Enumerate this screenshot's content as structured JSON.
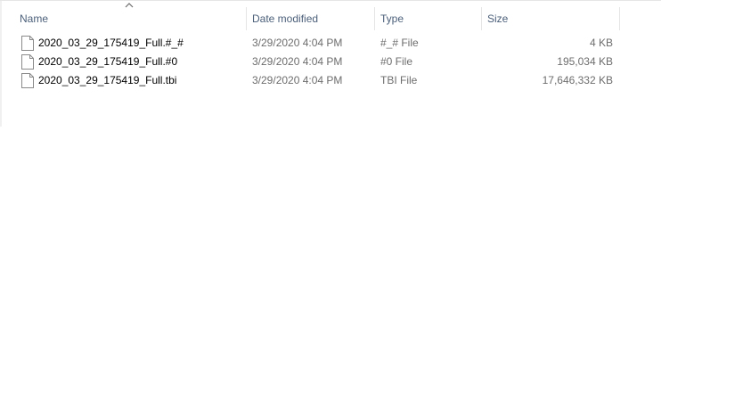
{
  "columns": {
    "name": "Name",
    "date_modified": "Date modified",
    "type": "Type",
    "size": "Size"
  },
  "sort": {
    "column": "name",
    "direction": "ascending",
    "icon": "sort-up-chevron-icon"
  },
  "files": [
    {
      "name": "2020_03_29_175419_Full.#_#",
      "date_modified": "3/29/2020 4:04 PM",
      "type": "#_# File",
      "size": "4 KB",
      "icon": "generic-file-icon"
    },
    {
      "name": "2020_03_29_175419_Full.#0",
      "date_modified": "3/29/2020 4:04 PM",
      "type": "#0 File",
      "size": "195,034 KB",
      "icon": "generic-file-icon"
    },
    {
      "name": "2020_03_29_175419_Full.tbi",
      "date_modified": "3/29/2020 4:04 PM",
      "type": "TBI File",
      "size": "17,646,332 KB",
      "icon": "generic-file-icon"
    }
  ],
  "colors": {
    "header_text": "#4c607a",
    "meta_text": "#6d6d6d",
    "divider": "#e5e5e5"
  }
}
